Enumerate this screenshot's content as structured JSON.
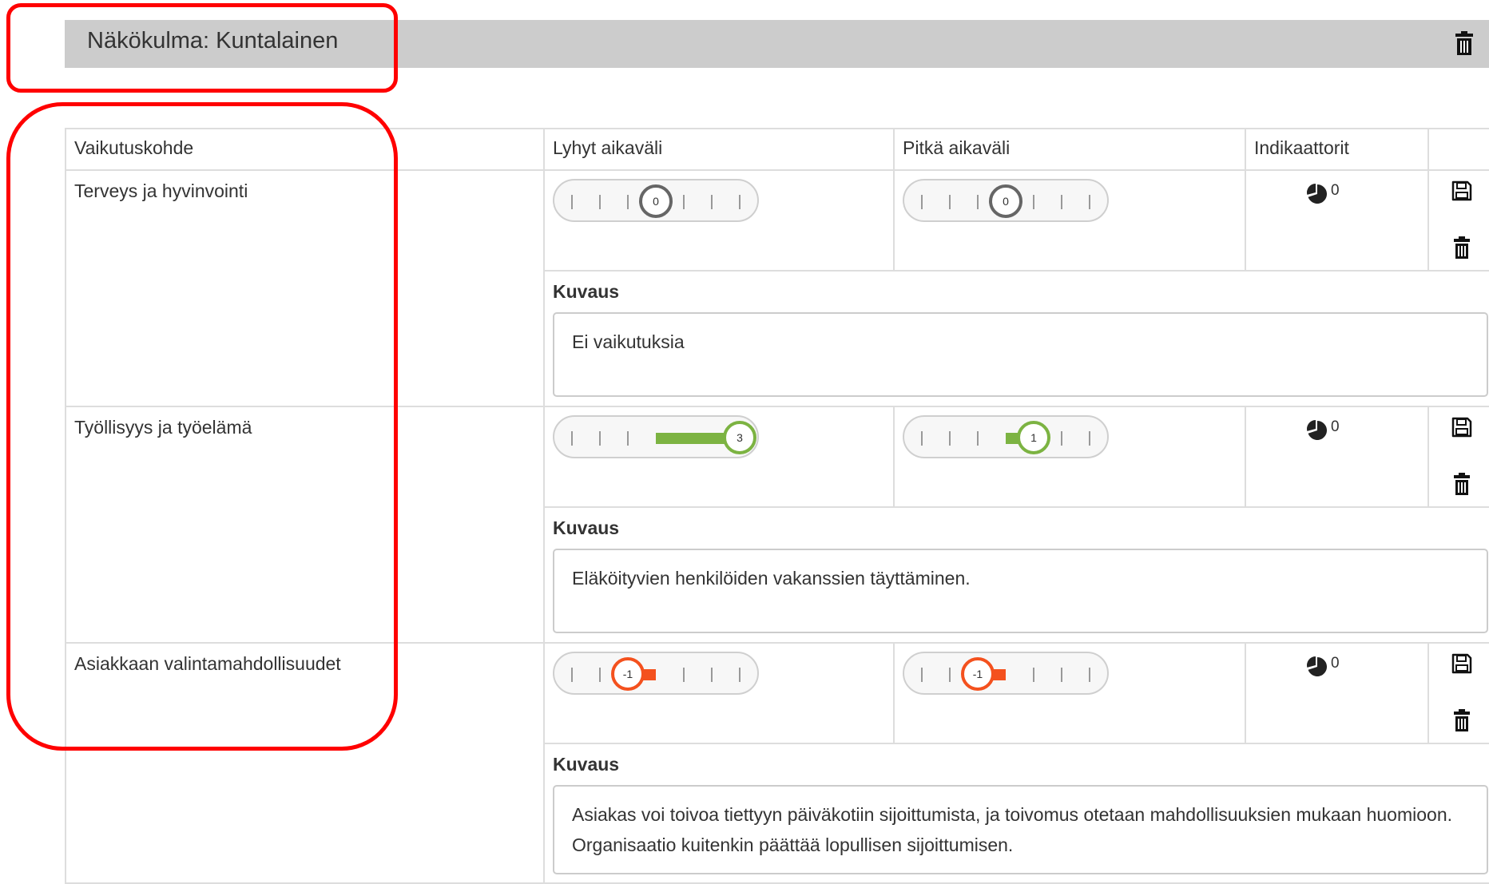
{
  "section": {
    "title": "Näkökulma: Kuntalainen"
  },
  "table": {
    "headers": [
      "Vaikutuskohde",
      "Lyhyt aikaväli",
      "Pitkä aikaväli",
      "Indikaattorit",
      ""
    ],
    "description_label": "Kuvaus",
    "rows": [
      {
        "target": "Terveys ja hyvinvointi",
        "short_term": "0",
        "long_term": "0",
        "indicator_count": "0",
        "description": "Ei vaikutuksia"
      },
      {
        "target": "Työllisyys ja työelämä",
        "short_term": "3",
        "long_term": "1",
        "indicator_count": "0",
        "description": "Eläköityvien henkilöiden vakanssien täyttäminen."
      },
      {
        "target": "Asiakkaan valintamahdollisuudet",
        "short_term": "-1",
        "long_term": "-1",
        "indicator_count": "0",
        "description": "Asiakas voi toivoa tiettyyn päiväkotiin sijoittumista, ja toivomus otetaan mahdollisuuksien mukaan huomioon. Organisaatio kuitenkin päättää lopullisen sijoittumisen."
      }
    ]
  },
  "slider_scale": {
    "min": -3,
    "max": 3
  },
  "colors": {
    "header_bg": "#cccccc",
    "positive": "#7cb342",
    "negative": "#f4511e",
    "neutral": "#666666",
    "highlight_outline": "#ff0000"
  },
  "icons": {
    "delete": "trash-icon",
    "save": "floppy-disk-icon",
    "indicators": "pie-chart-icon"
  }
}
